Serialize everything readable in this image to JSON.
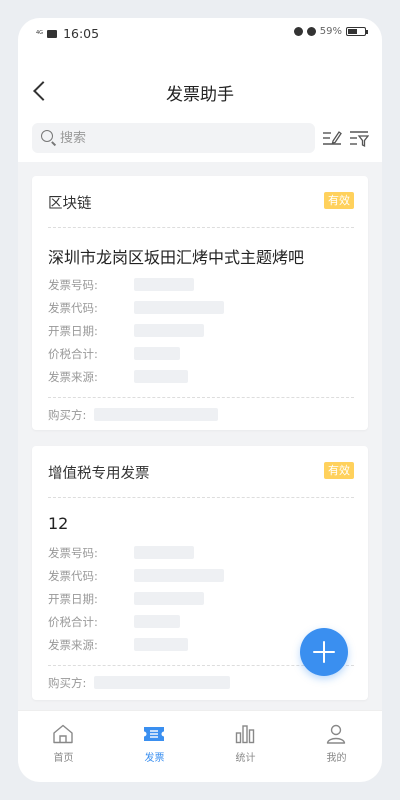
{
  "status_bar": {
    "network": "4G",
    "time": "16:05",
    "battery": "59%",
    "battery_level": 0.59
  },
  "header": {
    "title": "发票助手"
  },
  "search": {
    "placeholder": "搜索"
  },
  "invoices": [
    {
      "type": "区块链",
      "status": "有效",
      "merchant": "深圳市龙岗区坂田汇烤中式主题烤吧",
      "fields": [
        "发票号码:",
        "发票代码:",
        "开票日期:",
        "价税合计:",
        "发票来源:"
      ],
      "buyer_label": "购买方:"
    },
    {
      "type": "增值税专用发票",
      "status": "有效",
      "merchant": "12",
      "fields": [
        "发票号码:",
        "发票代码:",
        "开票日期:",
        "价税合计:",
        "发票来源:"
      ],
      "buyer_label": "购买方:"
    }
  ],
  "tabs": [
    {
      "label": "首页",
      "icon": "home-icon"
    },
    {
      "label": "发票",
      "icon": "invoice-icon"
    },
    {
      "label": "统计",
      "icon": "bar-chart-icon"
    },
    {
      "label": "我的",
      "icon": "user-icon"
    }
  ],
  "colors": {
    "accent": "#3a8ff0",
    "badge": "#ffd15c"
  }
}
